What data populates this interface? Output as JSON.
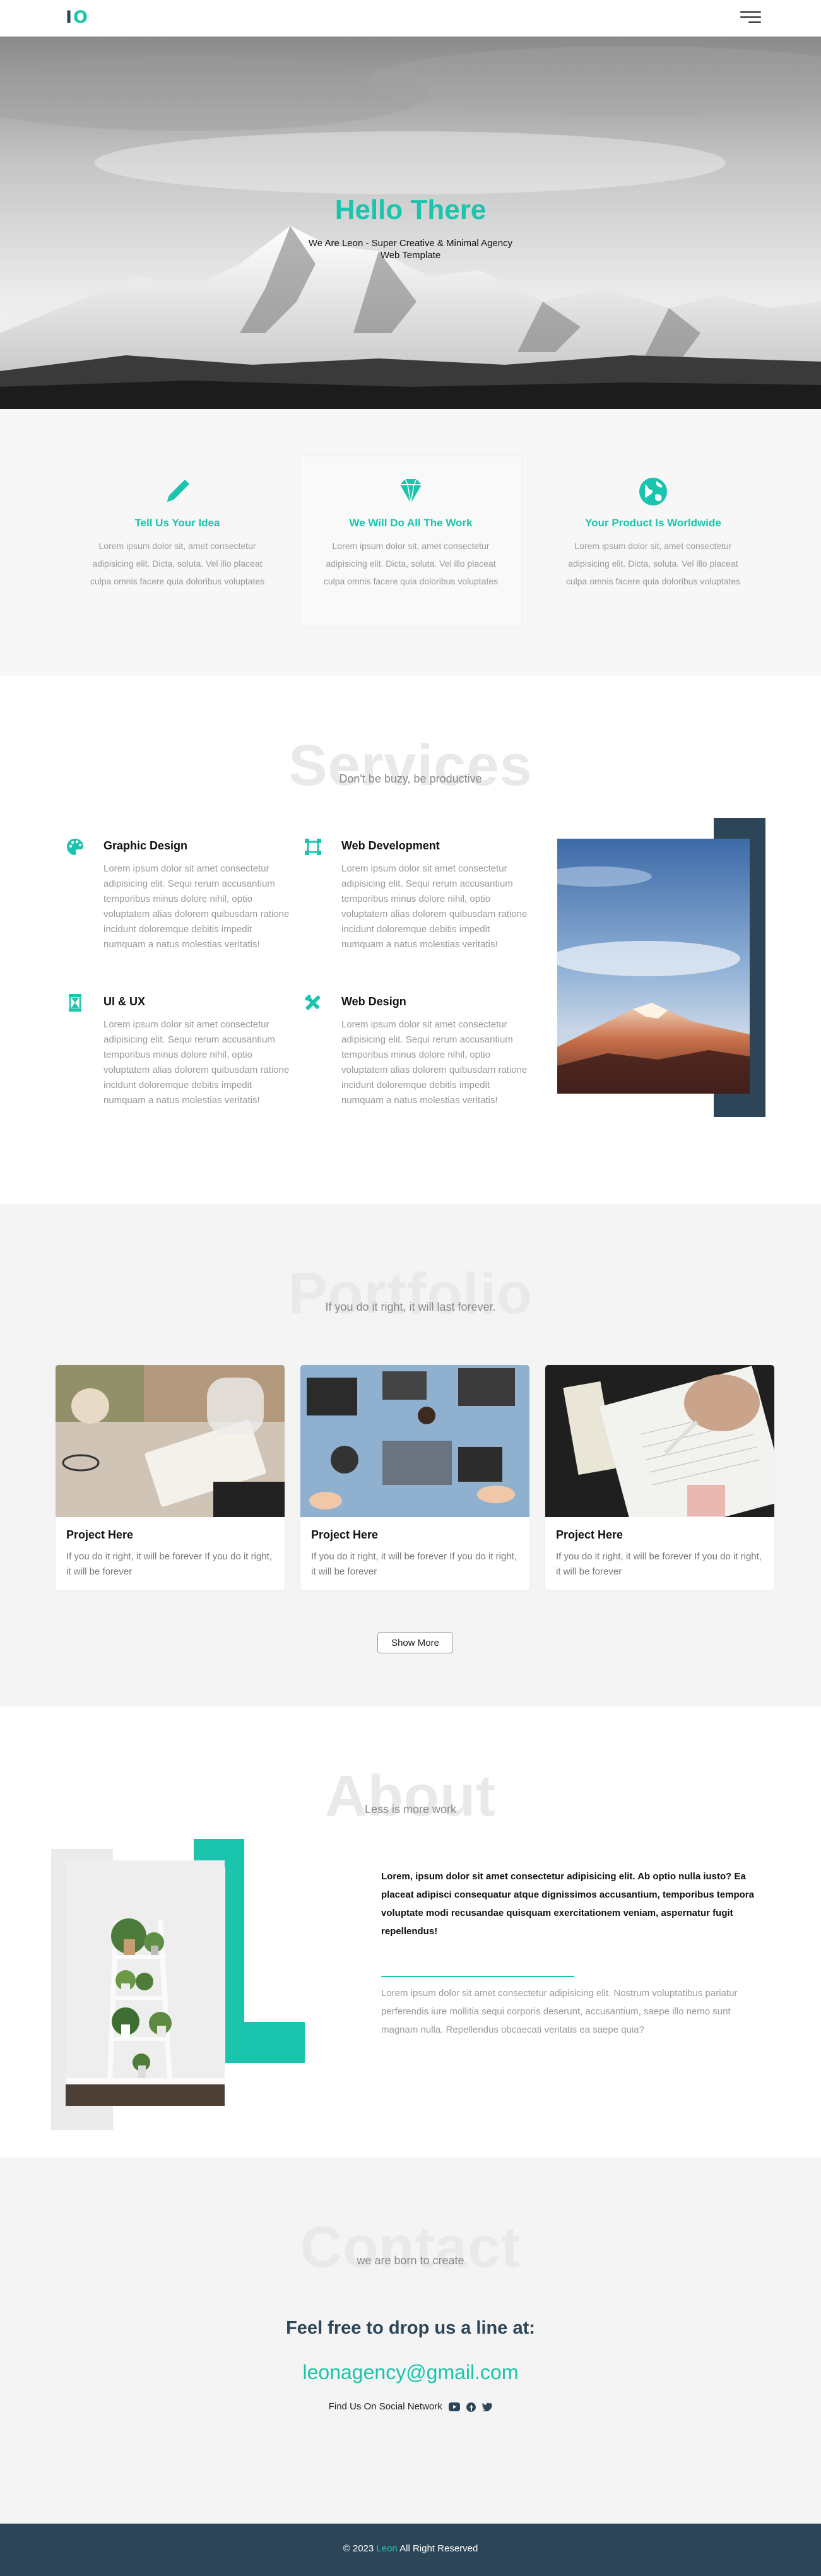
{
  "nav": {
    "logo_i": "I",
    "logo_o": "O"
  },
  "hero": {
    "title": "Hello There",
    "subtitle": "We Are Leon - Super Creative & Minimal Agency Web Template"
  },
  "features": [
    {
      "icon": "pencil-icon",
      "title": "Tell Us Your Idea",
      "text": "Lorem ipsum dolor sit, amet consectetur adipisicing elit. Dicta, soluta. Vel illo placeat culpa omnis facere quia doloribus voluptates"
    },
    {
      "icon": "diamond-icon",
      "title": "We Will Do All The Work",
      "text": "Lorem ipsum dolor sit, amet consectetur adipisicing elit. Dicta, soluta. Vel illo placeat culpa omnis facere quia doloribus voluptates"
    },
    {
      "icon": "globe-icon",
      "title": "Your Product Is Worldwide",
      "text": "Lorem ipsum dolor sit, amet consectetur adipisicing elit. Dicta, soluta. Vel illo placeat culpa omnis facere quia doloribus voluptates"
    }
  ],
  "services": {
    "bg_word": "Services",
    "subtitle": "Don't be buzy, be productive",
    "items": [
      {
        "icon": "palette-icon",
        "title": "Graphic Design",
        "text": "Lorem ipsum dolor sit amet consectetur adipisicing elit. Sequi rerum accusantium temporibus minus dolore nihil, optio voluptatem alias dolorem quibusdam ratione incidunt doloremque debitis impedit numquam a natus molestias veritatis!"
      },
      {
        "icon": "crop-icon",
        "title": "Web Development",
        "text": "Lorem ipsum dolor sit amet consectetur adipisicing elit. Sequi rerum accusantium temporibus minus dolore nihil, optio voluptatem alias dolorem quibusdam ratione incidunt doloremque debitis impedit numquam a natus molestias veritatis!"
      },
      {
        "icon": "hourglass-icon",
        "title": "UI & UX",
        "text": "Lorem ipsum dolor sit amet consectetur adipisicing elit. Sequi rerum accusantium temporibus minus dolore nihil, optio voluptatem alias dolorem quibusdam ratione incidunt doloremque debitis impedit numquam a natus molestias veritatis!"
      },
      {
        "icon": "tools-icon",
        "title": "Web Design",
        "text": "Lorem ipsum dolor sit amet consectetur adipisicing elit. Sequi rerum accusantium temporibus minus dolore nihil, optio voluptatem alias dolorem quibusdam ratione incidunt doloremque debitis impedit numquam a natus molestias veritatis!"
      }
    ]
  },
  "portfolio": {
    "bg_word": "Portfolio",
    "subtitle": "If you do it right, it will last forever.",
    "cards": [
      {
        "title": "Project Here",
        "text": "If you do it right, it will be forever If you do it right, it will be forever"
      },
      {
        "title": "Project Here",
        "text": "If you do it right, it will be forever If you do it right, it will be forever"
      },
      {
        "title": "Project Here",
        "text": "If you do it right, it will be forever If you do it right, it will be forever"
      }
    ],
    "show_more": "Show More"
  },
  "about": {
    "bg_word": "About",
    "subtitle": "Less is more work",
    "bold_text": "Lorem, ipsum dolor sit amet consectetur adipisicing elit. Ab optio nulla iusto? Ea placeat adipisci consequatur atque dignissimos accusantium, temporibus tempora voluptate modi recusandae quisquam exercitationem veniam, aspernatur fugit repellendus!",
    "text": "Lorem ipsum dolor sit amet consectetur adipisicing elit. Nostrum voluptatibus pariatur perferendis iure mollitia sequi corporis deserunt, accusantium, saepe illo nemo sunt magnam nulla. Repellendus obcaecati veritatis ea saepe quia?"
  },
  "contact": {
    "bg_word": "Contact",
    "subtitle": "we are born to create",
    "heading": "Feel free to drop us a line at:",
    "email": "leonagency@gmail.com",
    "social_label": "Find Us On Social Network"
  },
  "footer": {
    "prefix": "© 2023",
    "brand": "Leon",
    "suffix": "All Right Reserved"
  },
  "colors": {
    "accent": "#1bc4ac",
    "dark": "#2c4557"
  }
}
